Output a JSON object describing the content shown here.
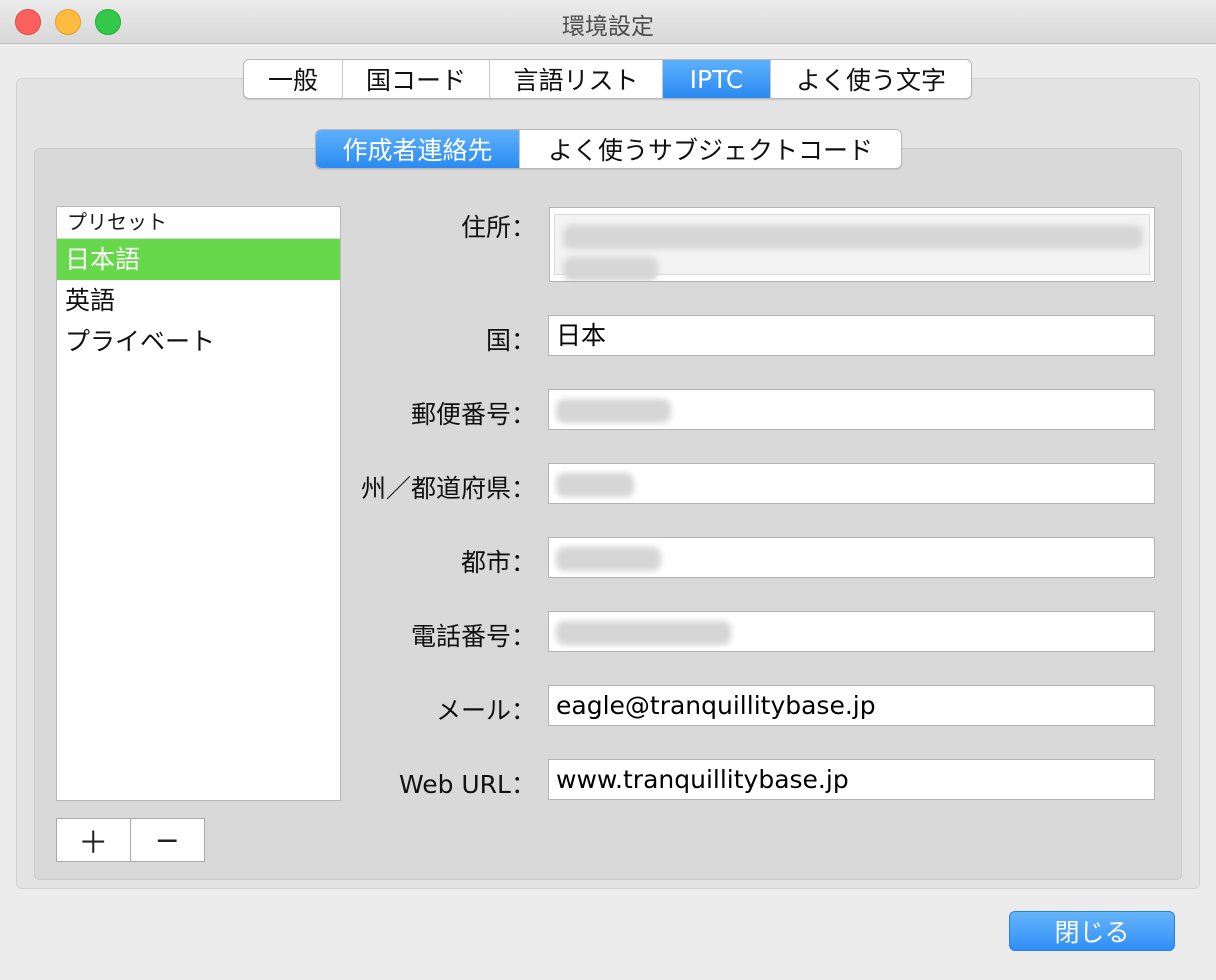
{
  "window": {
    "title": "環境設定"
  },
  "main_tabs": [
    {
      "label": "一般"
    },
    {
      "label": "国コード"
    },
    {
      "label": "言語リスト"
    },
    {
      "label": "IPTC"
    },
    {
      "label": "よく使う文字"
    }
  ],
  "sub_tabs": [
    {
      "label": "作成者連絡先"
    },
    {
      "label": "よく使うサブジェクトコード"
    }
  ],
  "preset_list": {
    "header": "プリセット",
    "items": [
      {
        "label": "日本語"
      },
      {
        "label": "英語"
      },
      {
        "label": "プライベート"
      }
    ],
    "add_label": "＋",
    "remove_label": "−"
  },
  "form": {
    "address_label": "住所：",
    "country_label": "国：",
    "country_value": "日本",
    "postal_label": "郵便番号：",
    "state_label": "州／都道府県：",
    "city_label": "都市：",
    "phone_label": "電話番号：",
    "email_label": "メール：",
    "email_value": "eagle@tranquillitybase.jp",
    "url_label": "Web URL：",
    "url_value": "www.tranquillitybase.jp"
  },
  "close_button": {
    "label": "閉じる"
  },
  "colors": {
    "accent_blue": "#2a8bf2",
    "selection_green": "#67d84b"
  }
}
